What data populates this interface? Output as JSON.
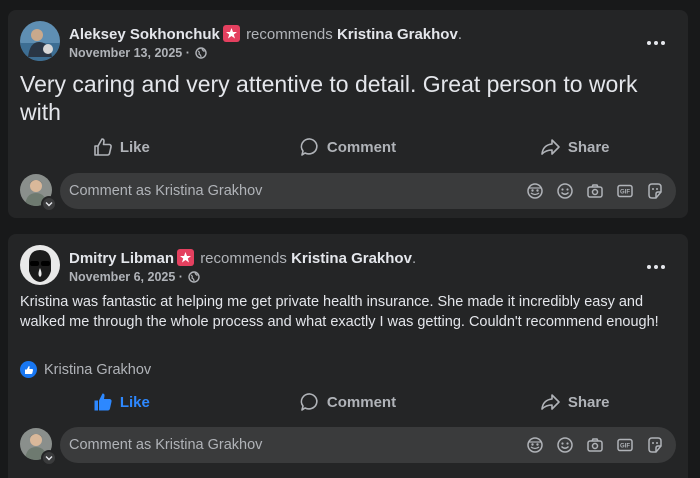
{
  "posts": [
    {
      "author": "Aleksey Sokhonchuk",
      "verb": "recommends",
      "target": "Kristina Grakhov",
      "date": "November 13, 2025 ·",
      "body": "Very caring and very attentive to detail. Great person to work with",
      "actions": {
        "like": "Like",
        "comment": "Comment",
        "share": "Share"
      },
      "comment_placeholder": "Comment as Kristina Grakhov"
    },
    {
      "author": "Dmitry Libman",
      "verb": "recommends",
      "target": "Kristina Grakhov",
      "date": "November 6, 2025 ·",
      "body": "Kristina was fantastic at helping me get private health insurance.  She made it incredibly easy and walked me through the whole process and what exactly I was getting. Couldn't recommend enough!",
      "liked_by": "Kristina Grakhov",
      "actions": {
        "like": "Like",
        "comment": "Comment",
        "share": "Share"
      },
      "comment_placeholder": "Comment as Kristina Grakhov"
    }
  ],
  "colors": {
    "background": "#18191a",
    "card": "#242526",
    "input": "#3a3b3c",
    "text": "#e4e6eb",
    "muted": "#b0b3b8",
    "like_blue": "#2d88ff",
    "badge_red": "#e4405f"
  },
  "icons": [
    "recommend-badge-icon",
    "globe-icon",
    "more-icon",
    "like-icon",
    "comment-icon",
    "share-icon",
    "avatar-icon",
    "sticker-avatar-icon",
    "emoji-icon",
    "camera-icon",
    "gif-icon",
    "sticker-icon"
  ]
}
